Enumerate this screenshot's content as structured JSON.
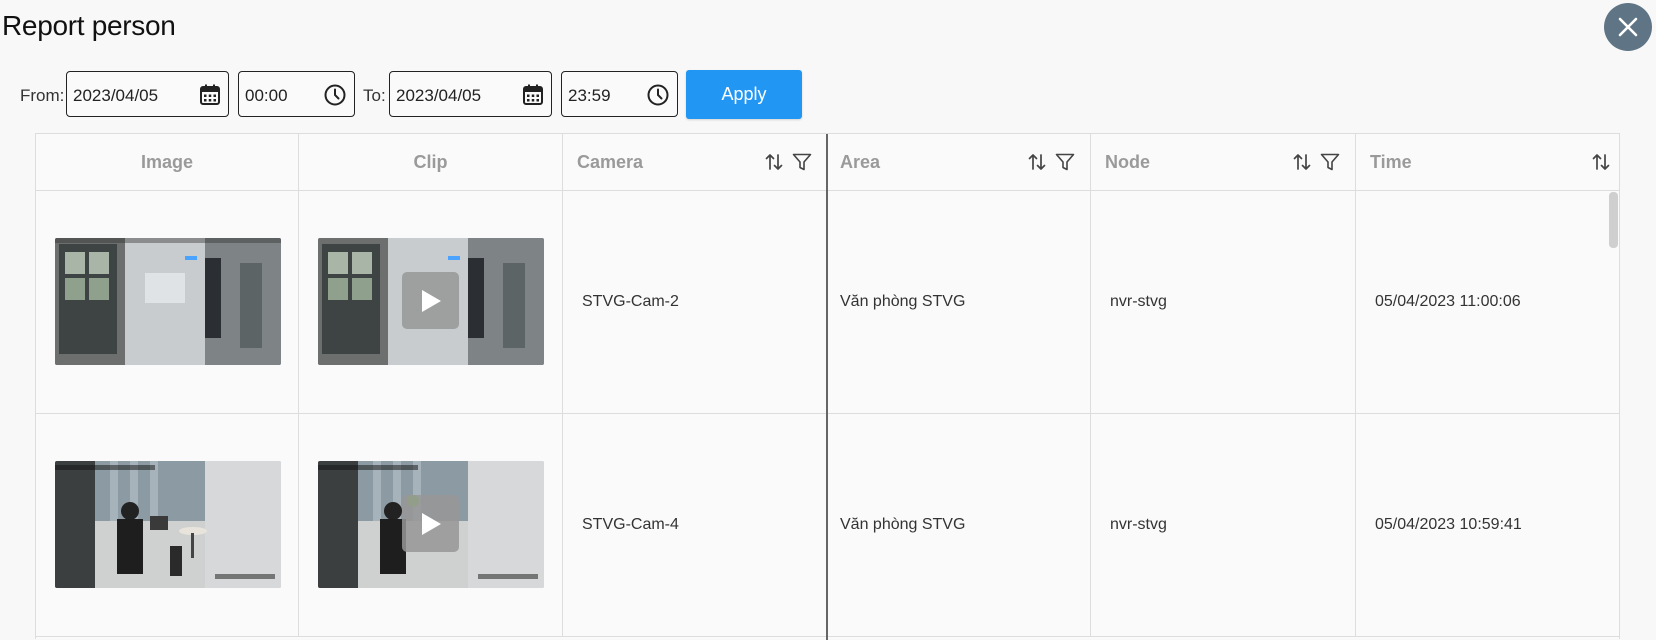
{
  "page": {
    "title": "Report person"
  },
  "toolbar": {
    "from_label": "From:",
    "from_date": "2023/04/05",
    "from_time": "00:00",
    "to_label": "To:",
    "to_date": "2023/04/05",
    "to_time": "23:59",
    "apply_label": "Apply"
  },
  "table": {
    "headers": {
      "image": "Image",
      "clip": "Clip",
      "camera": "Camera",
      "area": "Area",
      "node": "Node",
      "time": "Time"
    },
    "rows": [
      {
        "camera": "STVG-Cam-2",
        "area": "Văn phòng STVG",
        "node": "nvr-stvg",
        "time": "05/04/2023 11:00:06"
      },
      {
        "camera": "STVG-Cam-4",
        "area": "Văn phòng STVG",
        "node": "nvr-stvg",
        "time": "05/04/2023 10:59:41"
      }
    ]
  },
  "colors": {
    "accent": "#2196f3",
    "close_button": "#5f7585",
    "header_text": "#9a9a9a"
  },
  "icons": {
    "close": "close-icon",
    "calendar": "calendar-icon",
    "clock": "clock-icon",
    "sort": "sort-icon",
    "filter": "filter-icon",
    "play": "play-icon"
  }
}
